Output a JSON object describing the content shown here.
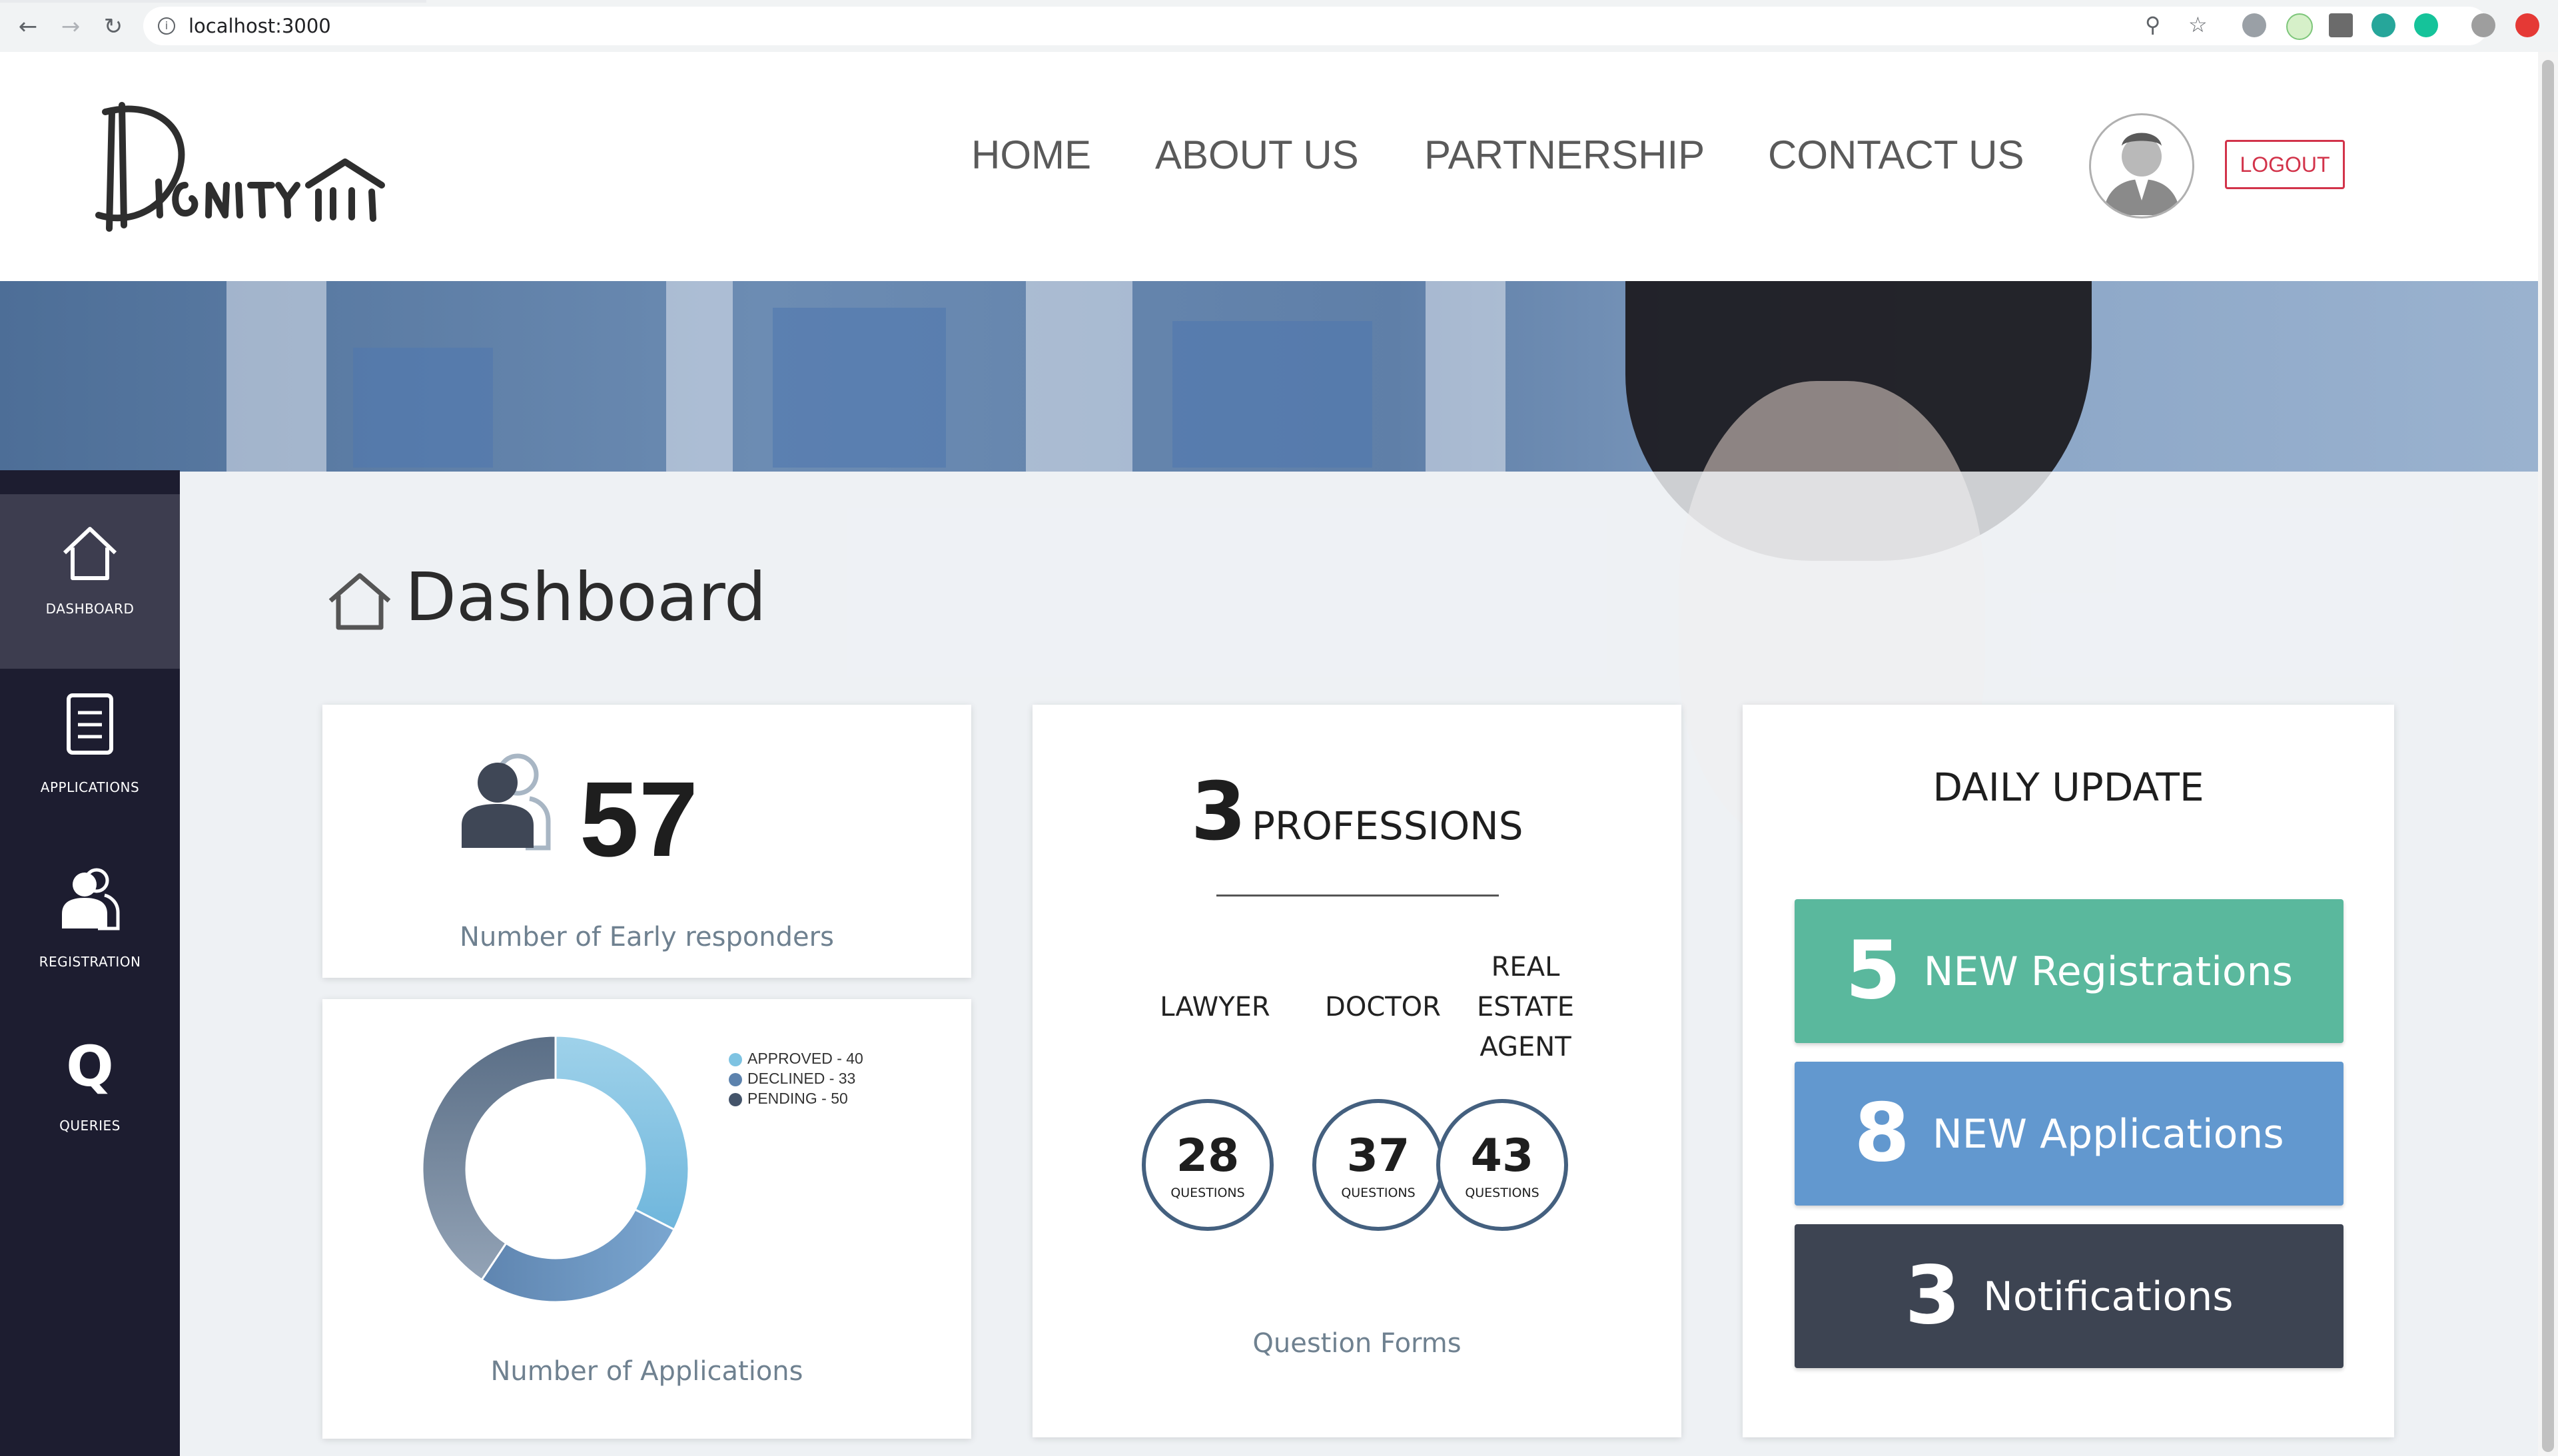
{
  "browser": {
    "url": "localhost:3000"
  },
  "header": {
    "logo_text": "Dignity",
    "nav": [
      {
        "label": "HOME"
      },
      {
        "label": "ABOUT US"
      },
      {
        "label": "PARTNERSHIP"
      },
      {
        "label": "CONTACT US"
      }
    ],
    "logout_label": "LOGOUT"
  },
  "sidebar": {
    "items": [
      {
        "label": "DASHBOARD",
        "icon": "home-icon",
        "active": true
      },
      {
        "label": "APPLICATIONS",
        "icon": "document-icon",
        "active": false
      },
      {
        "label": "REGISTRATION",
        "icon": "users-icon",
        "active": false
      },
      {
        "label": "QUERIES",
        "icon": "q-icon",
        "active": false
      }
    ]
  },
  "dashboard": {
    "title": "Dashboard",
    "responders": {
      "count": "57",
      "caption": "Number of Early responders"
    },
    "applications": {
      "caption": "Number of Applications",
      "legend": [
        {
          "label": "APPROVED - 40",
          "color": "#7ec3e2"
        },
        {
          "label": "DECLINED - 33",
          "color": "#5c82ad"
        },
        {
          "label": "PENDING - 50",
          "color": "#44546a"
        }
      ]
    },
    "professions": {
      "count": "3",
      "label": "PROFESSIONS",
      "items": [
        {
          "name": "LAWYER",
          "questions": "28",
          "word": "QUESTIONS"
        },
        {
          "name": "DOCTOR",
          "questions": "37",
          "word": "QUESTIONS"
        },
        {
          "name": "REAL\nESTATE\nAGENT",
          "questions": "43",
          "word": "QUESTIONS"
        }
      ],
      "caption": "Question Forms"
    },
    "daily_update": {
      "title": "DAILY UPDATE",
      "tiles": [
        {
          "count": "5",
          "label": "NEW Registrations",
          "color": "#5ab89d"
        },
        {
          "count": "8",
          "label": "NEW Applications",
          "color": "#6298cf"
        },
        {
          "count": "3",
          "label": "Notifications",
          "color": "#3d4452"
        }
      ]
    }
  },
  "chart_data": {
    "type": "pie",
    "categories": [
      "APPROVED",
      "DECLINED",
      "PENDING"
    ],
    "values": [
      40,
      33,
      50
    ],
    "donut": true
  }
}
